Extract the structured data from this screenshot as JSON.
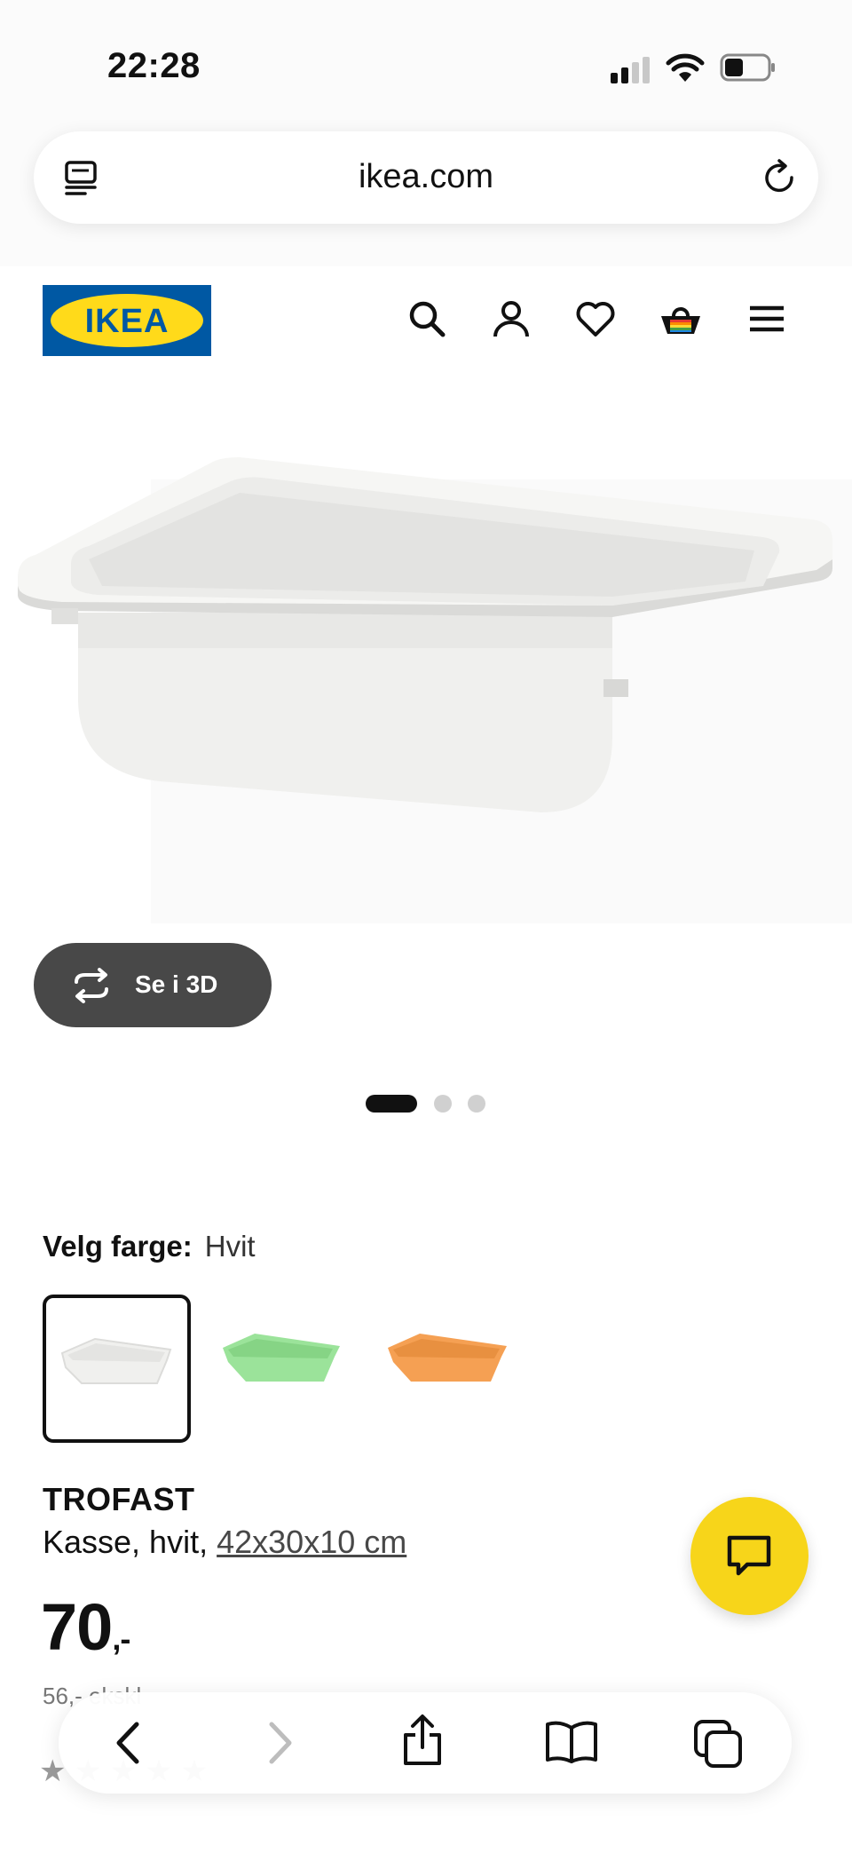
{
  "status": {
    "time": "22:28"
  },
  "browser": {
    "url": "ikea.com"
  },
  "site": {
    "logo_text": "IKEA",
    "logo_blue": "#0058a3",
    "logo_yellow": "#ffda1a",
    "header_icons": [
      "search-icon",
      "profile-icon",
      "heart-icon",
      "cart-icon",
      "menu-icon"
    ]
  },
  "gallery": {
    "view_3d_label": "Se i 3D",
    "image_count": 3,
    "active_index": 0
  },
  "color_picker": {
    "label": "Velg farge:",
    "selected": "Hvit",
    "swatches": [
      {
        "name": "white",
        "color": "#f4f4f2"
      },
      {
        "name": "green",
        "color": "#9be39a"
      },
      {
        "name": "orange",
        "color": "#f5a053"
      }
    ]
  },
  "product": {
    "name": "TROFAST",
    "description": "Kasse, hvit,",
    "dimensions": "42x30x10 cm",
    "price": "70",
    "price_suffix": ",-",
    "unit_price_partial": "56,- ekskl"
  },
  "chat": {
    "color": "#f7d51a"
  },
  "toolbar": {
    "icons": [
      "back-icon",
      "forward-icon",
      "share-icon",
      "bookmarks-icon",
      "tabs-icon"
    ]
  }
}
